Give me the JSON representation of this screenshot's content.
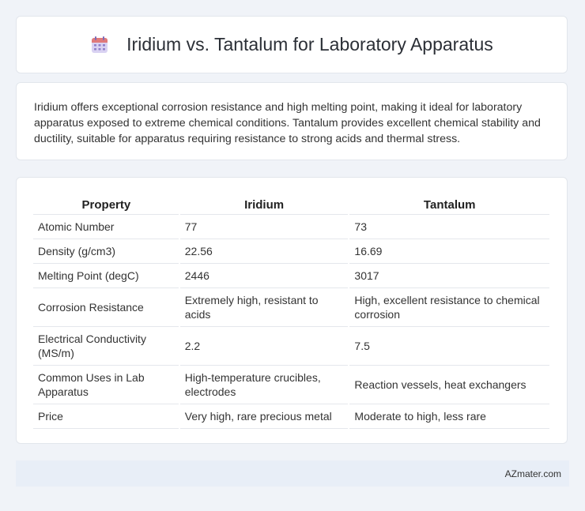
{
  "header": {
    "title": "Iridium vs. Tantalum for Laboratory Apparatus",
    "icon": "calendar-icon"
  },
  "intro": {
    "text": "Iridium offers exceptional corrosion resistance and high melting point, making it ideal for laboratory apparatus exposed to extreme chemical conditions. Tantalum provides excellent chemical stability and ductility, suitable for apparatus requiring resistance to strong acids and thermal stress."
  },
  "table": {
    "headers": [
      "Property",
      "Iridium",
      "Tantalum"
    ],
    "rows": [
      [
        "Atomic Number",
        "77",
        "73"
      ],
      [
        "Density (g/cm3)",
        "22.56",
        "16.69"
      ],
      [
        "Melting Point (degC)",
        "2446",
        "3017"
      ],
      [
        "Corrosion Resistance",
        "Extremely high, resistant to acids",
        "High, excellent resistance to chemical corrosion"
      ],
      [
        "Electrical Conductivity (MS/m)",
        "2.2",
        "7.5"
      ],
      [
        "Common Uses in Lab Apparatus",
        "High-temperature crucibles, electrodes",
        "Reaction vessels, heat exchangers"
      ],
      [
        "Price",
        "Very high, rare precious metal",
        "Moderate to high, less rare"
      ]
    ]
  },
  "footer": {
    "brand": "AZmater.com"
  }
}
